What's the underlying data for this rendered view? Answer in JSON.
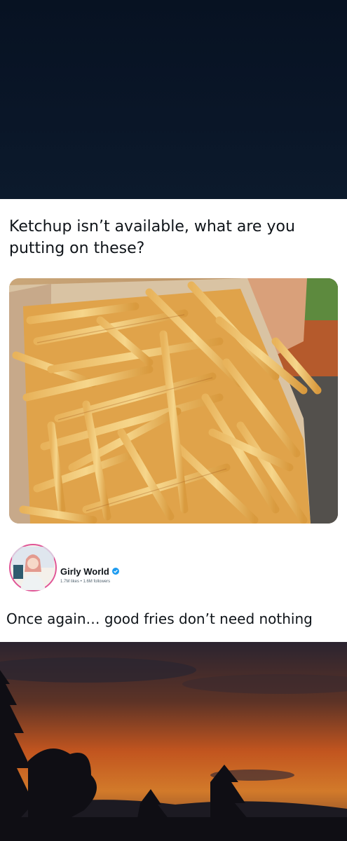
{
  "post": {
    "text": "Ketchup isn’t available, what are you putting on these?",
    "image_icon": "french-fries-photo"
  },
  "author": {
    "name": "Girly World",
    "meta": "1.7M likes • 1.6M followers",
    "verified_icon": "verified-badge-icon",
    "avatar_icon": "profile-avatar"
  },
  "caption": "Once again… good fries don’t need nothing",
  "colors": {
    "top_bg": "#0a1628",
    "verified": "#1d9bf0",
    "sunset_orange": "#c2551f",
    "text": "#0f1419"
  },
  "bottom_image_icon": "sunset-landscape-photo"
}
